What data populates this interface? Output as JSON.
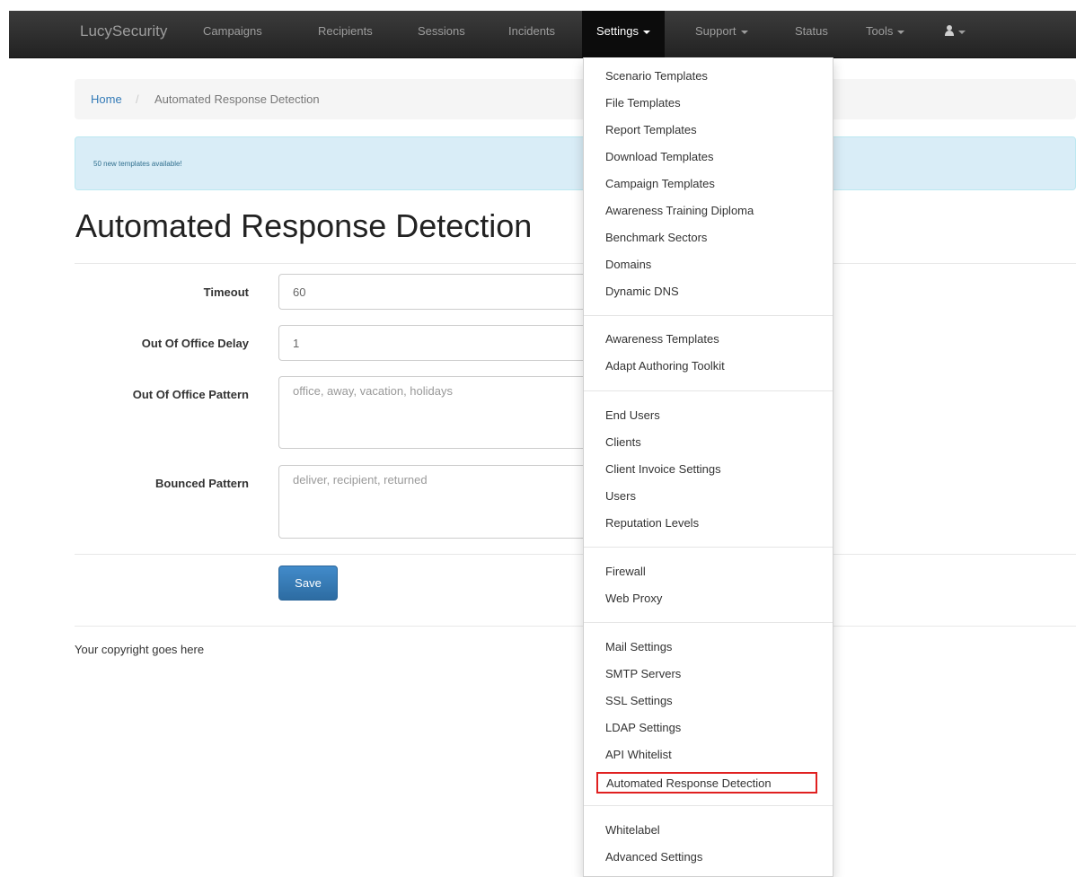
{
  "navbar": {
    "brand": "LucySecurity",
    "items": [
      "Campaigns",
      "Recipients",
      "Sessions",
      "Incidents"
    ],
    "settings": "Settings",
    "support": "Support",
    "status": "Status",
    "tools": "Tools",
    "user_icon": "user-icon"
  },
  "breadcrumb": {
    "home": "Home",
    "separator": "/",
    "current": "Automated Response Detection"
  },
  "alert": {
    "text": "50 new templates available!"
  },
  "page": {
    "title": "Automated Response Detection"
  },
  "form": {
    "timeout": {
      "label": "Timeout",
      "value": "60"
    },
    "ooo_delay": {
      "label": "Out Of Office Delay",
      "value": "1"
    },
    "ooo_pattern": {
      "label": "Out Of Office Pattern",
      "placeholder": "office, away, vacation, holidays"
    },
    "bounced": {
      "label": "Bounced Pattern",
      "placeholder": "deliver, recipient, returned"
    },
    "save": "Save"
  },
  "footer": {
    "text": "Your copyright goes here"
  },
  "dropdown": {
    "items": [
      "Scenario Templates",
      "File Templates",
      "Report Templates",
      "Download Templates",
      "Campaign Templates",
      "Awareness Training Diploma",
      "Benchmark Sectors",
      "Domains",
      "Dynamic DNS",
      "Awareness Templates",
      "Adapt Authoring Toolkit",
      "End Users",
      "Clients",
      "Client Invoice Settings",
      "Users",
      "Reputation Levels",
      "Firewall",
      "Web Proxy",
      "Mail Settings",
      "SMTP Servers",
      "SSL Settings",
      "LDAP Settings",
      "API Whitelist",
      "Automated Response Detection",
      "Whitelabel",
      "Advanced Settings"
    ]
  },
  "colors": {
    "navbar": "#222222",
    "link": "#337ab7",
    "alert_bg": "#d9edf7",
    "primary": "#337ab7",
    "highlight_border": "#e02020"
  }
}
